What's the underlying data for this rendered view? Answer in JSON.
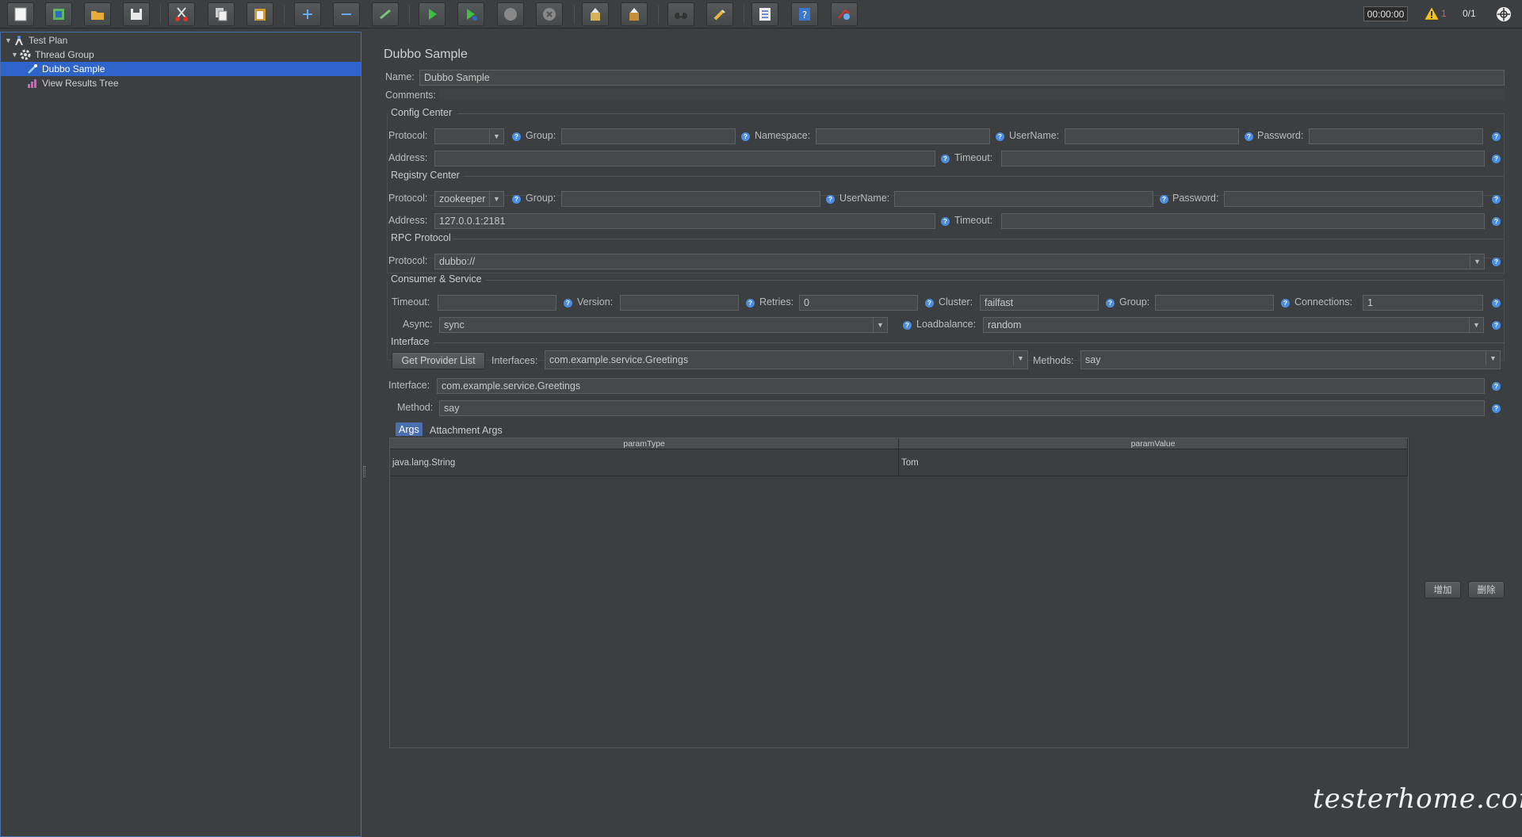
{
  "toolbar": {
    "timer": "00:00:00",
    "warning_count": "1",
    "thread_count": "0/1",
    "buttons": [
      "new-icon",
      "templates-icon",
      "open-icon",
      "save-icon",
      "cut-icon",
      "copy-icon",
      "paste-icon",
      "expand-icon",
      "collapse-icon",
      "toggle-icon",
      "start-icon",
      "start-no-pauses-icon",
      "stop-icon",
      "shutdown-icon",
      "clear-icon",
      "clear-all-icon",
      "search-icon",
      "reset-search-icon",
      "function-helper-icon",
      "help-icon",
      "remote-icon"
    ]
  },
  "tree": {
    "items": [
      {
        "label": "Test Plan",
        "icon": "test-plan-icon"
      },
      {
        "label": "Thread Group",
        "icon": "gear-icon"
      },
      {
        "label": "Dubbo Sample",
        "icon": "sampler-icon"
      },
      {
        "label": "View Results Tree",
        "icon": "listener-icon"
      }
    ]
  },
  "main": {
    "title": "Dubbo Sample",
    "name_label": "Name:",
    "name_value": "Dubbo Sample",
    "comments_label": "Comments:",
    "config_center": {
      "title": "Config Center",
      "protocol_label": "Protocol:",
      "protocol_value": "",
      "group_label": "Group:",
      "namespace_label": "Namespace:",
      "username_label": "UserName:",
      "password_label": "Password:",
      "address_label": "Address:",
      "timeout_label": "Timeout:"
    },
    "registry_center": {
      "title": "Registry Center",
      "protocol_label": "Protocol:",
      "protocol_value": "zookeeper",
      "group_label": "Group:",
      "username_label": "UserName:",
      "password_label": "Password:",
      "address_label": "Address:",
      "address_value": "127.0.0.1:2181",
      "timeout_label": "Timeout:"
    },
    "rpc_protocol": {
      "title": "RPC Protocol",
      "protocol_label": "Protocol:",
      "protocol_value": "dubbo://"
    },
    "consumer_service": {
      "title": "Consumer & Service",
      "timeout_label": "Timeout:",
      "version_label": "Version:",
      "retries_label": "Retries:",
      "retries_value": "0",
      "cluster_label": "Cluster:",
      "cluster_value": "failfast",
      "group_label": "Group:",
      "connections_label": "Connections:",
      "connections_value": "1",
      "async_label": "Async:",
      "async_value": "sync",
      "loadbalance_label": "Loadbalance:",
      "loadbalance_value": "random"
    },
    "interface": {
      "title": "Interface",
      "get_provider_button": "Get Provider List",
      "interfaces_label": "Interfaces:",
      "interfaces_value": "com.example.service.Greetings",
      "methods_label": "Methods:",
      "methods_value": "say",
      "interface_label": "Interface:",
      "interface_value": "com.example.service.Greetings",
      "method_label": "Method:",
      "method_value": "say"
    },
    "tabs": [
      "Args",
      "Attachment Args"
    ],
    "args_table": {
      "headers": [
        "paramType",
        "paramValue"
      ],
      "rows": [
        [
          "java.lang.String",
          "Tom"
        ]
      ]
    },
    "add_button": "增加",
    "delete_button": "删除"
  },
  "watermark": "testerhome.com"
}
